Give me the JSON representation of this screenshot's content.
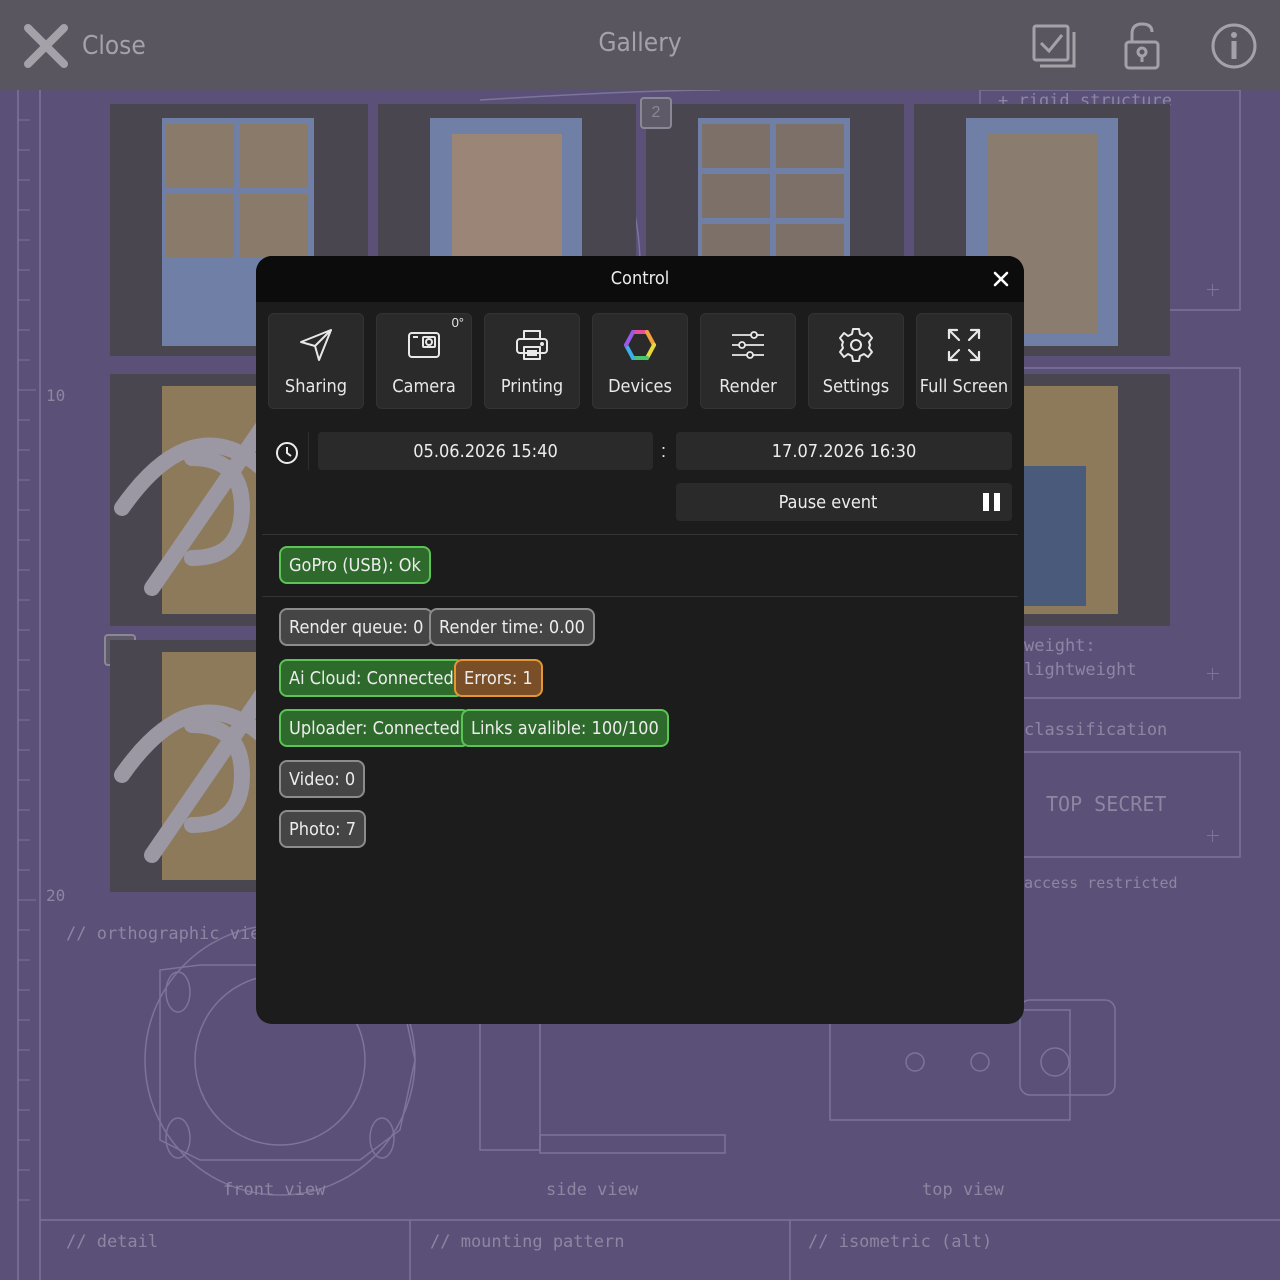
{
  "topbar": {
    "close_label": "Close",
    "title": "Gallery"
  },
  "gallery": {
    "badges": [
      "2",
      "2"
    ]
  },
  "blueprint": {
    "labels": [
      "front view",
      "side view",
      "top view",
      "// orthographic view",
      "// detail",
      "// mounting pattern",
      "// isometric (alt)",
      "+ rigid structure",
      "TOP SECRET",
      "classification",
      "access restricted",
      "weight:",
      "lightweight"
    ],
    "ruler": [
      "10",
      "20"
    ]
  },
  "modal": {
    "title": "Control",
    "tools": [
      {
        "label": "Sharing",
        "icon": "send-icon"
      },
      {
        "label": "Camera",
        "icon": "camera-icon",
        "badge": "0°"
      },
      {
        "label": "Printing",
        "icon": "printer-icon"
      },
      {
        "label": "Devices",
        "icon": "devices-hexagon-icon"
      },
      {
        "label": "Render",
        "icon": "sliders-icon"
      },
      {
        "label": "Settings",
        "icon": "gear-icon"
      },
      {
        "label": "Full Screen",
        "icon": "fullscreen-icon"
      }
    ],
    "schedule": {
      "start": "05.06.2026 15:40",
      "separator": ":",
      "end": "17.07.2026 16:30",
      "pause_label": "Pause event"
    },
    "status": {
      "gopro": "GoPro (USB): Ok",
      "render_queue": "Render queue: 0",
      "render_time": "Render time: 0.00",
      "ai_cloud": "Ai Cloud: Connected",
      "errors": "Errors: 1",
      "uploader": "Uploader: Connected",
      "links": "Links avalible: 100/100",
      "video": "Video: 0",
      "photo": "Photo: 7"
    }
  },
  "colors": {
    "ok": "#5ac454",
    "neutral": "#8c8c8c",
    "warning": "#e49634",
    "modal_bg": "#1c1c1c"
  }
}
